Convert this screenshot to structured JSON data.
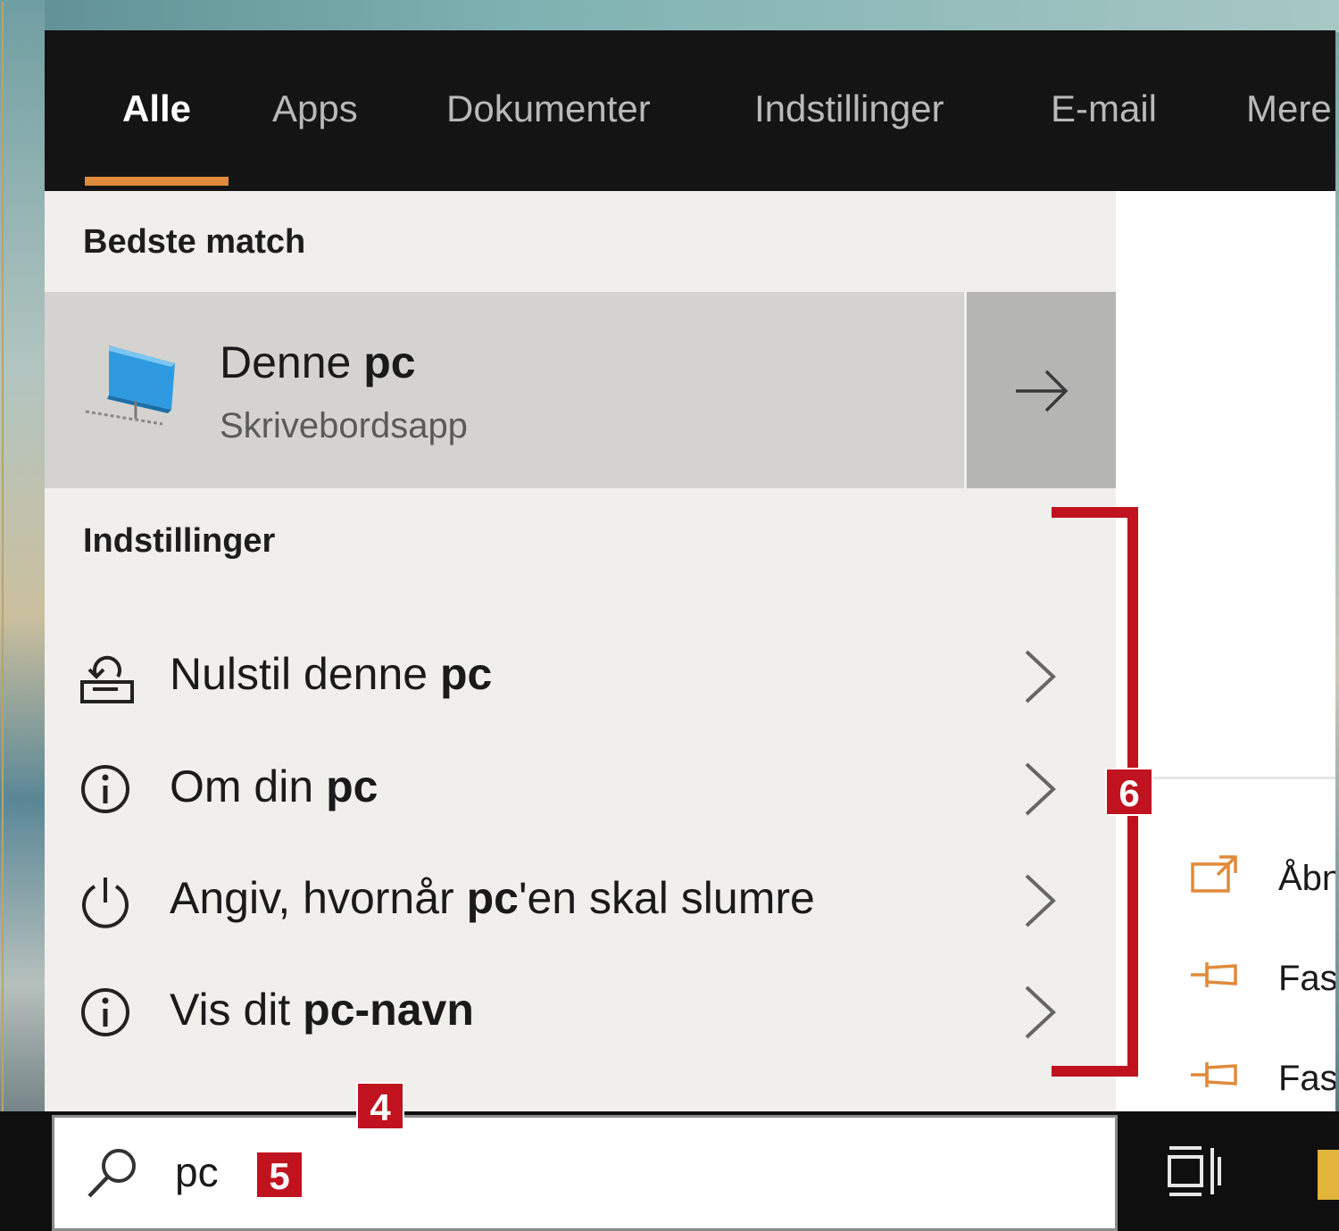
{
  "tabs": [
    {
      "label": "Alle",
      "active": true
    },
    {
      "label": "Apps"
    },
    {
      "label": "Dokumenter"
    },
    {
      "label": "Indstillinger"
    },
    {
      "label": "E-mail"
    },
    {
      "label": "Mere"
    }
  ],
  "best_match": {
    "heading": "Bedste match",
    "name_pre": "Denne ",
    "name_bold": "pc",
    "subtitle": "Skrivebordsapp",
    "icon": "this-pc-icon"
  },
  "settings": {
    "heading": "Indstillinger",
    "items": [
      {
        "pre": "Nulstil denne ",
        "bold": "pc",
        "post": "",
        "icon": "reset-pc-icon"
      },
      {
        "pre": "Om din ",
        "bold": "pc",
        "post": "",
        "icon": "info-icon"
      },
      {
        "pre": "Angiv, hvornår ",
        "bold": "pc",
        "post": "'en skal slumre",
        "icon": "power-icon"
      },
      {
        "pre": "Vis dit ",
        "bold": "pc-navn",
        "post": "",
        "icon": "info-icon"
      }
    ]
  },
  "right_panel": {
    "items": [
      {
        "label": "Åbn",
        "icon": "open-icon"
      },
      {
        "label": "Fastgør til Start",
        "icon": "pin-icon"
      },
      {
        "label": "Fastgør til proceslinjen",
        "icon": "pin-icon"
      }
    ]
  },
  "search": {
    "query": "pc"
  },
  "annotations": {
    "badge_4": "4",
    "badge_5": "5",
    "badge_6": "6"
  },
  "colors": {
    "accent": "#e08a3c",
    "annotation": "#c0121f",
    "tab_bar": "#141414",
    "results_bg": "#f0efec"
  }
}
